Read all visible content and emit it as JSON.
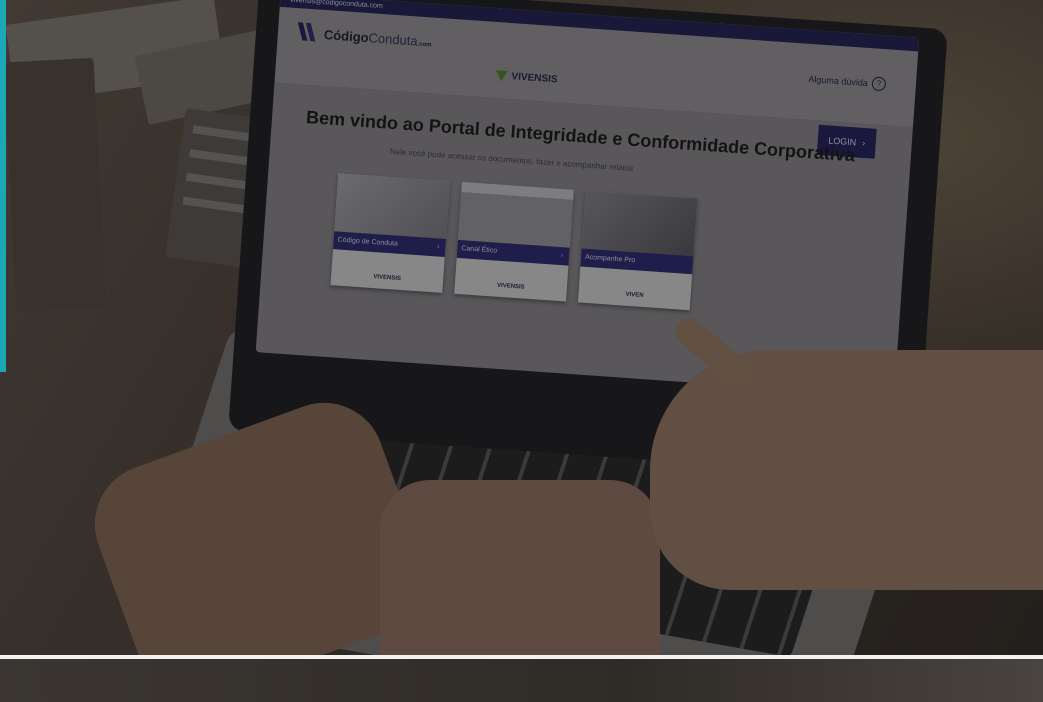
{
  "screen": {
    "email": "vivensis@codigoconduta.com",
    "logo_bold": "Código",
    "logo_regular": "Conduta",
    "logo_suffix": ".com",
    "help_text": "Alguma dúvida",
    "help_icon": "question-circle-icon",
    "brand": "VIVENSIS",
    "login_label": "LOGIN",
    "welcome_title": "Bem vindo ao Portal de Integridade e Conformidade Corporativa",
    "subtitle": "Nele você pode acessar os documentos, fazer e acompanhar relatos",
    "cards": [
      {
        "label": "Código de Conduta",
        "brand": "VIVENSIS"
      },
      {
        "label": "Canal Ético",
        "brand": "VIVENSIS"
      },
      {
        "label": "Acompanhe Pro",
        "brand": "VIVEN"
      }
    ],
    "arrow": "›"
  },
  "colors": {
    "teal_edge": "#1aa7b8",
    "navy": "#1e1d55",
    "vivensis_green": "#4b7a2a"
  }
}
